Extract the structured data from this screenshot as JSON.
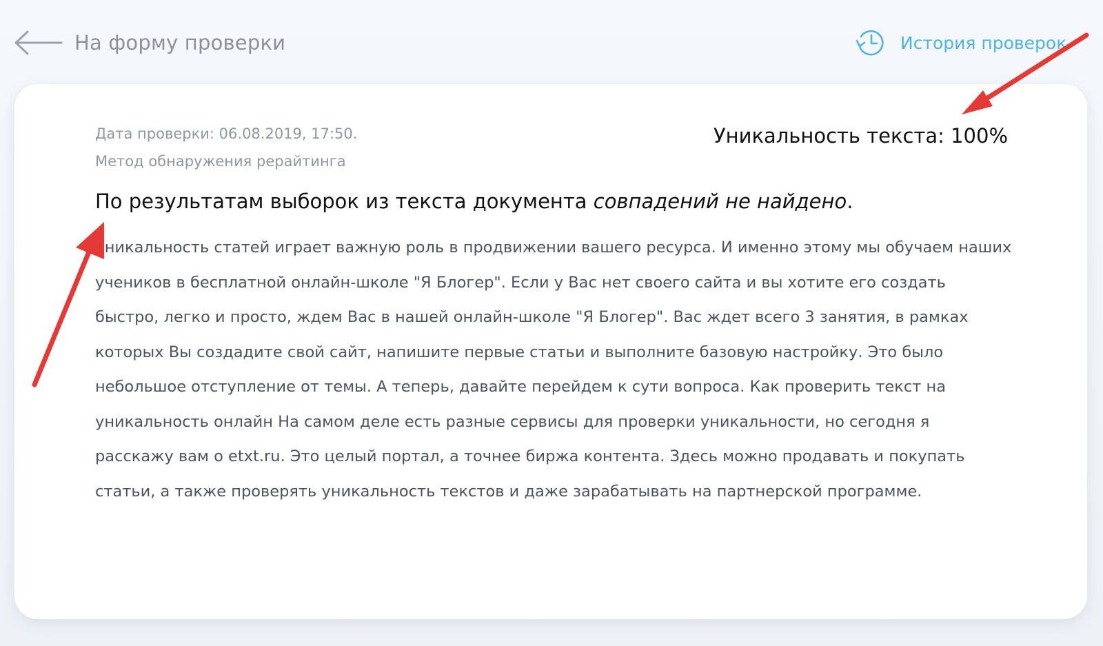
{
  "nav": {
    "back_label": "На форму проверки",
    "history_label": "История проверок"
  },
  "report": {
    "date_line": "Дата проверки: 06.08.2019, 17:50.",
    "method_line": "Метод обнаружения рерайтинга",
    "uniqueness_label": "Уникальность текста: 100%",
    "result_prefix": "По результатам выборок из текста документа ",
    "result_emphasis": "совпадений не найдено",
    "result_suffix": ".",
    "body_text": "Уникальность статей играет важную роль в продвижении вашего ресурса. И именно этому мы обучаем наших учеников в бесплатной онлайн-школе \"Я Блогер\". Если у Вас нет своего сайта и вы хотите его создать быстро, легко и просто, ждем Вас в нашей онлайн-школе \"Я Блогер\". Вас ждет всего 3 занятия, в рамках которых Вы создадите свой сайт, напишите первые статьи и выполните базовую настройку. Это было небольшое отступление от темы. А теперь, давайте перейдем к сути вопроса. Как проверить текст на уникальность онлайн На самом деле есть разные сервисы для проверки уникальности, но сегодня я расскажу вам о etxt.ru. Это целый портал, а точнее биржа контента. Здесь можно продавать и покупать статьи, а также проверять уникальность текстов и даже зарабатывать на партнерской программе."
  },
  "icons": {
    "back": "arrow-left-icon",
    "history": "history-clock-icon"
  },
  "colors": {
    "link_blue": "#4fb3e6",
    "muted_gray": "#8a929c",
    "annotation_red": "#e53935"
  }
}
